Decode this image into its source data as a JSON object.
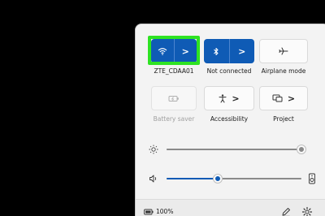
{
  "quick_settings": {
    "tiles_row1": [
      {
        "label": "ZTE_CDAA01",
        "icon": "wifi-icon",
        "state": "on"
      },
      {
        "label": "Not connected",
        "icon": "bluetooth-icon",
        "state": "on"
      },
      {
        "label": "Airplane mode",
        "icon": "airplane-icon",
        "state": "off"
      }
    ],
    "tiles_row2": [
      {
        "label": "Battery saver",
        "icon": "battery-saver-icon",
        "state": "disabled"
      },
      {
        "label": "Accessibility",
        "icon": "accessibility-icon",
        "state": "off"
      },
      {
        "label": "Project",
        "icon": "project-icon",
        "state": "off"
      }
    ],
    "chevron": ">"
  },
  "sliders": {
    "brightness": {
      "icon": "brightness-icon",
      "level": 1.0
    },
    "volume": {
      "icon": "volume-icon",
      "level": 0.38,
      "end_icon": "audio-output-icon"
    }
  },
  "footer": {
    "battery_text": "100%",
    "battery_icon": "battery-icon",
    "edit_icon": "pencil-icon",
    "settings_icon": "gear-icon"
  },
  "colors": {
    "accent": "#0f5bb5",
    "highlight": "#2ee322",
    "panel": "#f3f3f3"
  }
}
